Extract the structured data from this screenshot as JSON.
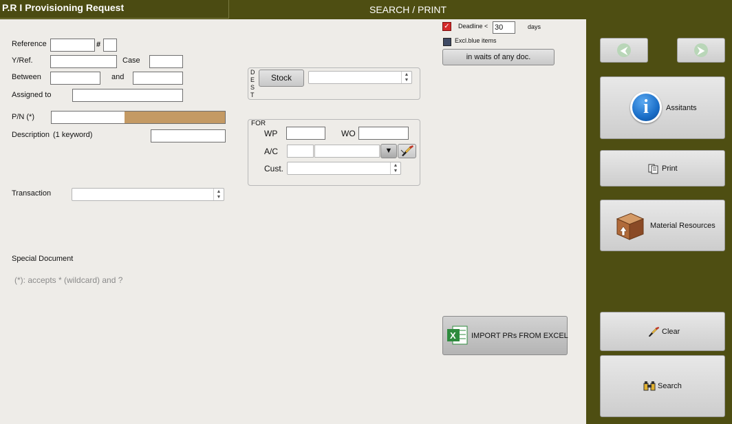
{
  "window": {
    "title": "P.R I Provisioning Request",
    "mode": "SEARCH / PRINT"
  },
  "form": {
    "reference_label": "Reference",
    "hash_label": "#",
    "yref_label": "Y/Ref.",
    "case_label": "Case",
    "between_label": "Between",
    "and_label": "and",
    "assigned_label": "Assigned to",
    "pn_label": "P/N (*)",
    "description_label": "Description",
    "description_hint": "(1 keyword)",
    "transaction_label": "Transaction",
    "special_doc_label": "Special Document",
    "wildcard_note": "(*): accepts * (wildcard) and ?"
  },
  "dest": {
    "vertical_label": [
      "D",
      "E",
      "S",
      "T"
    ],
    "stock_button": "Stock"
  },
  "for_group": {
    "title": "FOR",
    "wp_label": "WP",
    "wo_label": "WO",
    "ac_label": "A/C",
    "cust_label": "Cust.",
    "dropdown_glyph": "▼"
  },
  "filters": {
    "deadline_label": "Deadline <",
    "deadline_value": "30",
    "days_label": "days",
    "deadline_checked": true,
    "excl_blue_label": "Excl.blue items",
    "waits_button": "in waits of any doc."
  },
  "import_button": "IMPORT PRs FROM EXCEL",
  "sidebar": {
    "assistants": "Assitants",
    "print": "Print",
    "material_resources": "Material Resources",
    "clear": "Clear",
    "search": "Search"
  },
  "colors": {
    "frame": "#4e4e12",
    "panel": "#eeece8",
    "pn_fill": "#c49a64",
    "info_blue": "#1a6ec8",
    "excel_green": "#2e8b3e"
  }
}
